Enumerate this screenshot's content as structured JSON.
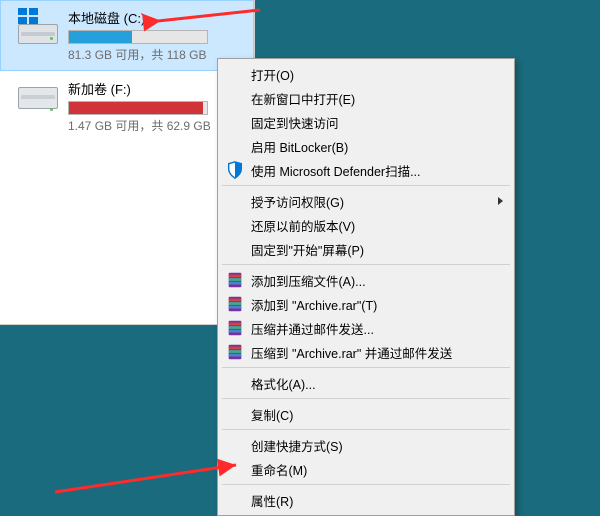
{
  "drives": [
    {
      "name": "本地磁盘 (C:)",
      "sub": "81.3 GB 可用，共 118 GB",
      "fill_pct": 46,
      "fill_color": "blue",
      "selected": true,
      "os": true
    },
    {
      "name": "新加卷 (F:)",
      "sub": "1.47 GB 可用，共 62.9 GB",
      "fill_pct": 97,
      "fill_color": "red",
      "selected": false,
      "os": false
    }
  ],
  "menu": [
    {
      "type": "item",
      "label": "打开(O)"
    },
    {
      "type": "item",
      "label": "在新窗口中打开(E)"
    },
    {
      "type": "item",
      "label": "固定到快速访问"
    },
    {
      "type": "item",
      "label": "启用 BitLocker(B)"
    },
    {
      "type": "item",
      "label": "使用 Microsoft Defender扫描...",
      "icon": "shield"
    },
    {
      "type": "sep"
    },
    {
      "type": "item",
      "label": "授予访问权限(G)",
      "submenu": true
    },
    {
      "type": "item",
      "label": "还原以前的版本(V)"
    },
    {
      "type": "item",
      "label": "固定到\"开始\"屏幕(P)"
    },
    {
      "type": "sep"
    },
    {
      "type": "item",
      "label": "添加到压缩文件(A)...",
      "icon": "rar"
    },
    {
      "type": "item",
      "label": "添加到 \"Archive.rar\"(T)",
      "icon": "rar"
    },
    {
      "type": "item",
      "label": "压缩并通过邮件发送...",
      "icon": "rar"
    },
    {
      "type": "item",
      "label": "压缩到 \"Archive.rar\" 并通过邮件发送",
      "icon": "rar"
    },
    {
      "type": "sep"
    },
    {
      "type": "item",
      "label": "格式化(A)..."
    },
    {
      "type": "sep"
    },
    {
      "type": "item",
      "label": "复制(C)"
    },
    {
      "type": "sep"
    },
    {
      "type": "item",
      "label": "创建快捷方式(S)"
    },
    {
      "type": "item",
      "label": "重命名(M)"
    },
    {
      "type": "sep"
    },
    {
      "type": "item",
      "label": "属性(R)"
    }
  ]
}
